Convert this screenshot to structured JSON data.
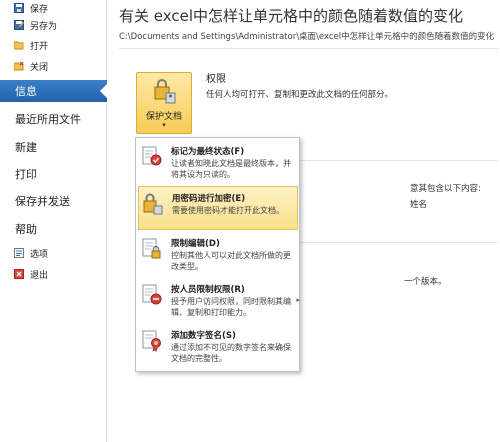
{
  "sidebar": {
    "small_top": [
      {
        "label": "保存",
        "icon": "save-icon"
      },
      {
        "label": "另存为",
        "icon": "save-as-icon"
      },
      {
        "label": "打开",
        "icon": "folder-open-icon"
      },
      {
        "label": "关闭",
        "icon": "folder-close-icon"
      }
    ],
    "big": [
      {
        "label": "信息",
        "active": true
      },
      {
        "label": "最近所用文件"
      },
      {
        "label": "新建"
      },
      {
        "label": "打印"
      },
      {
        "label": "保存并发送"
      },
      {
        "label": "帮助"
      }
    ],
    "small_bottom": [
      {
        "label": "选项",
        "icon": "options-icon"
      },
      {
        "label": "退出",
        "icon": "exit-icon"
      }
    ]
  },
  "main": {
    "title": "有关 excel中怎样让单元格中的颜色随着数值的变化",
    "path": "C:\\Documents and Settings\\Administrator\\桌面\\excel中怎样让单元格中的颜色随着数值的变化",
    "protect_button": {
      "label": "保护文档",
      "caret": "▾"
    },
    "permissions": {
      "title": "权限",
      "description": "任何人均可打开、复制和更改此文档的任何部分。"
    },
    "background_text": {
      "line1": "意其包含以下内容:",
      "line2": "姓名",
      "line3": "一个版本。"
    }
  },
  "menu": {
    "items": [
      {
        "title": "标记为最终状态(F)",
        "desc": "让读者知晓此文档是最终版本，并将其设为只读的。",
        "icon": "mark-final-icon"
      },
      {
        "title": "用密码进行加密(E)",
        "desc": "需要使用密码才能打开此文档。",
        "icon": "encrypt-lock-icon",
        "highlighted": true
      },
      {
        "title": "限制编辑(D)",
        "desc": "控制其他人可以对此文档所做的更改类型。",
        "icon": "restrict-edit-icon"
      },
      {
        "title": "按人员限制权限(R)",
        "desc": "授予用户访问权限，同时限制其编辑、复制和打印能力。",
        "icon": "restrict-permission-icon",
        "arrow": "▸"
      },
      {
        "title": "添加数字签名(S)",
        "desc": "通过添加不可见的数字签名来确保文档的完整性。",
        "icon": "digital-signature-icon"
      }
    ]
  },
  "colors": {
    "active_blue": "#2a6fba",
    "highlight_yellow": "#fbe08a"
  }
}
